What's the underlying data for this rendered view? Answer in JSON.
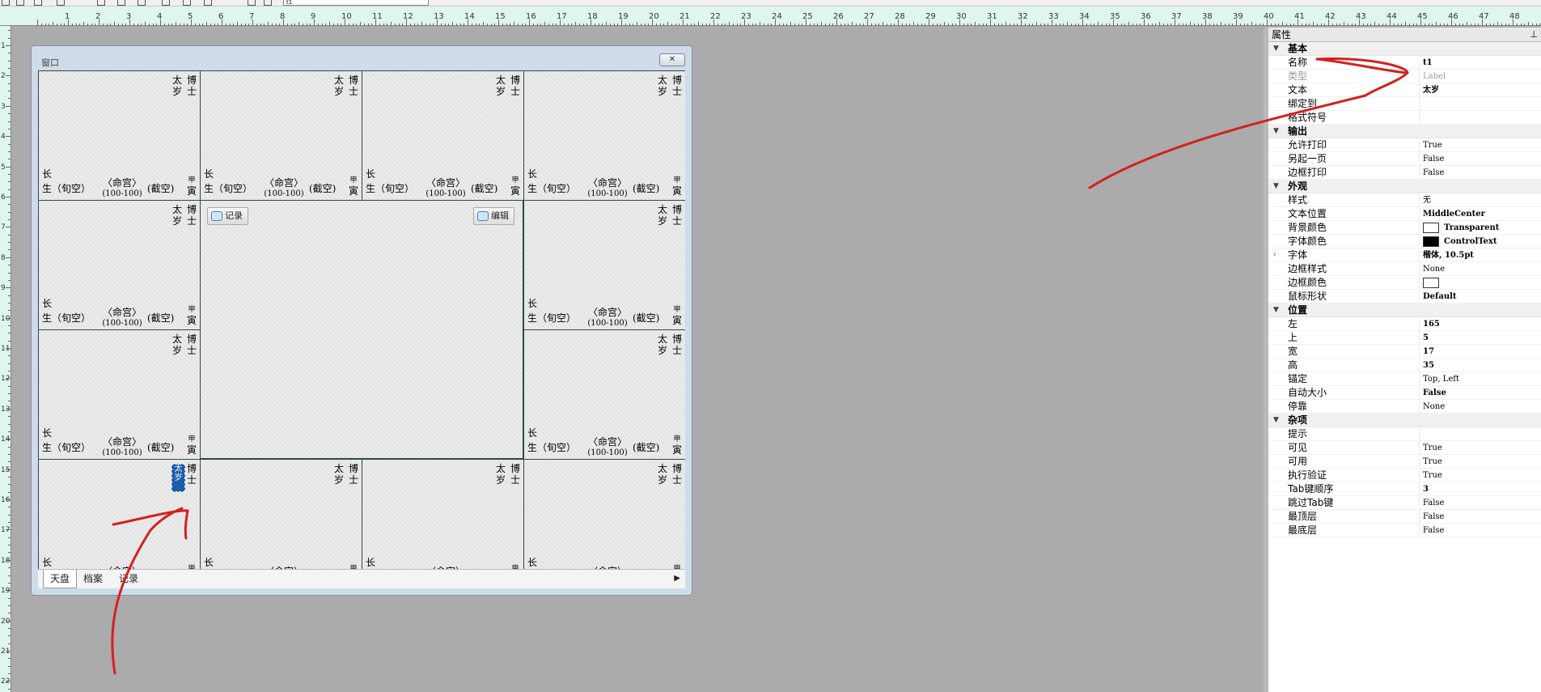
{
  "toolbar": {
    "combo_value": "t1"
  },
  "rulers": {
    "top_labels": [
      "1",
      "2",
      "3",
      "4",
      "5",
      "6",
      "7",
      "8",
      "9",
      "10",
      "11",
      "12",
      "13",
      "14",
      "15",
      "16",
      "17",
      "18",
      "19",
      "20",
      "21",
      "22",
      "23",
      "24",
      "25",
      "26",
      "27",
      "28",
      "29",
      "30",
      "31",
      "32",
      "33",
      "34",
      "35",
      "36",
      "37",
      "38",
      "39",
      "40",
      "41",
      "42",
      "43",
      "44",
      "45",
      "46",
      "47",
      "48"
    ],
    "left_labels": [
      "1",
      "2",
      "3",
      "4",
      "5",
      "6",
      "7",
      "8",
      "9",
      "10",
      "11",
      "12",
      "13",
      "14",
      "15",
      "16",
      "17",
      "18",
      "19",
      "20",
      "21",
      "22"
    ]
  },
  "window": {
    "title": "窗口",
    "close_symbol": "✕",
    "center_buttons": {
      "record": "记录",
      "edit": "编辑"
    },
    "tabs": [
      "天盘",
      "档案",
      "记录"
    ],
    "tab_scroll": "▶",
    "selected_label_text": "太岁",
    "cell": {
      "top_right_col1": [
        "太",
        "岁"
      ],
      "top_right_col2": [
        "博",
        "士"
      ],
      "bottom_left_1": "长",
      "bottom_left_2": "生（旬空）",
      "palace": "〈命宫〉",
      "range": "(100-100)",
      "kong": "(截空)",
      "stem": "甲",
      "branch": "寅"
    }
  },
  "properties": {
    "title": "属性",
    "pin": "⊥",
    "categories": [
      {
        "name": "基本",
        "rows": [
          {
            "name": "名称",
            "value": "t1",
            "bold": true
          },
          {
            "name": "类型",
            "value": "Label",
            "disabled": true
          },
          {
            "name": "文本",
            "value": "太岁",
            "bold": true
          },
          {
            "name": "绑定到",
            "value": ""
          },
          {
            "name": "格式符号",
            "value": ""
          }
        ]
      },
      {
        "name": "输出",
        "rows": [
          {
            "name": "允许打印",
            "value": "True"
          },
          {
            "name": "另起一页",
            "value": "False"
          },
          {
            "name": "边框打印",
            "value": "False"
          }
        ]
      },
      {
        "name": "外观",
        "rows": [
          {
            "name": "样式",
            "value": "无"
          },
          {
            "name": "文本位置",
            "value": "MiddleCenter",
            "bold": true
          },
          {
            "name": "背景颜色",
            "value": "Transparent",
            "bold": true,
            "swatch": "#ffffff"
          },
          {
            "name": "字体颜色",
            "value": "ControlText",
            "bold": true,
            "swatch": "#000000"
          },
          {
            "name": "字体",
            "value": "楷体, 10.5pt",
            "bold": true,
            "expandable": true
          },
          {
            "name": "边框样式",
            "value": "None"
          },
          {
            "name": "边框颜色",
            "value": "",
            "swatch": "#ffffff"
          },
          {
            "name": "鼠标形状",
            "value": "Default",
            "bold": true
          }
        ]
      },
      {
        "name": "位置",
        "rows": [
          {
            "name": "左",
            "value": "165",
            "bold": true
          },
          {
            "name": "上",
            "value": "5",
            "bold": true
          },
          {
            "name": "宽",
            "value": "17",
            "bold": true
          },
          {
            "name": "高",
            "value": "35",
            "bold": true
          },
          {
            "name": "锚定",
            "value": "Top, Left"
          },
          {
            "name": "自动大小",
            "value": "False",
            "bold": true
          },
          {
            "name": "停靠",
            "value": "None"
          }
        ]
      },
      {
        "name": "杂项",
        "rows": [
          {
            "name": "提示",
            "value": ""
          },
          {
            "name": "可见",
            "value": "True"
          },
          {
            "name": "可用",
            "value": "True"
          },
          {
            "name": "执行验证",
            "value": "True"
          },
          {
            "name": "Tab键顺序",
            "value": "3",
            "bold": true
          },
          {
            "name": "跳过Tab键",
            "value": "False"
          },
          {
            "name": "最顶层",
            "value": "False"
          },
          {
            "name": "最底层",
            "value": "False"
          }
        ]
      }
    ]
  },
  "colors": {
    "annotation": "#d42020",
    "cell_border": "#2e4a42",
    "selection": "#1c5ea8"
  }
}
